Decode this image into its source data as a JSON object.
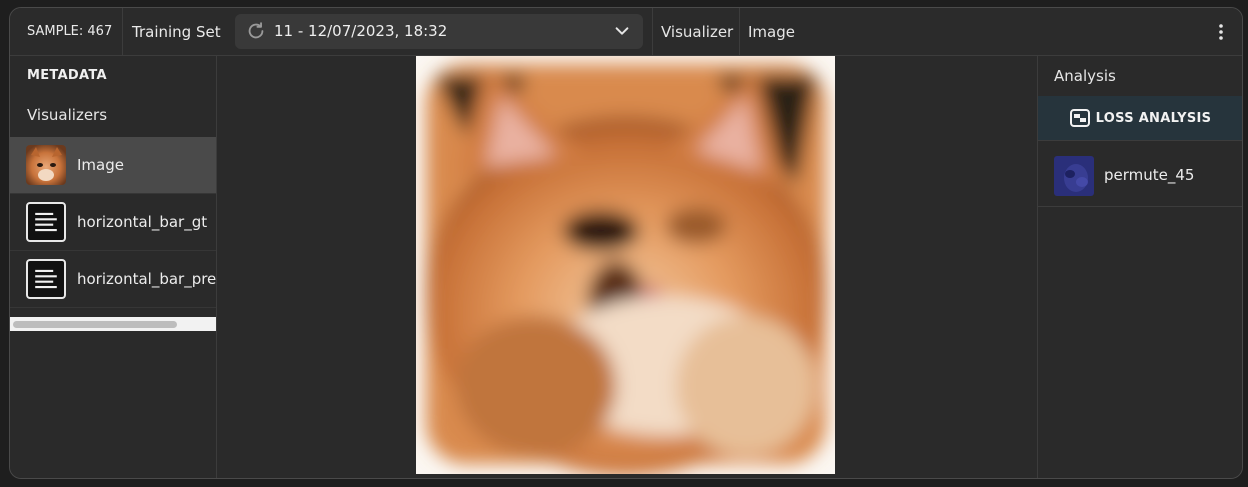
{
  "header": {
    "sample_label": "SAMPLE: 467",
    "dataset_label": "Training Set",
    "version_text": "11 - 12/07/2023, 18:32",
    "visualizer_label": "Visualizer",
    "visualizer_value": "Image"
  },
  "sidebar": {
    "title": "METADATA",
    "subtitle": "Visualizers",
    "items": [
      {
        "label": "Image",
        "icon": "cat-thumbnail",
        "active": true
      },
      {
        "label": "horizontal_bar_gt",
        "icon": "document-lines-icon",
        "active": false
      },
      {
        "label": "horizontal_bar_pred",
        "icon": "document-lines-icon",
        "active": false
      }
    ]
  },
  "analysis": {
    "title": "Analysis",
    "loss_button": "LOSS ANALYSIS",
    "items": [
      {
        "label": "permute_45",
        "icon": "heatmap-thumbnail"
      }
    ]
  },
  "colors": {
    "background": "#2a2a2a",
    "active_item": "#4a4a4a",
    "loss_button_bg": "#26343c"
  }
}
